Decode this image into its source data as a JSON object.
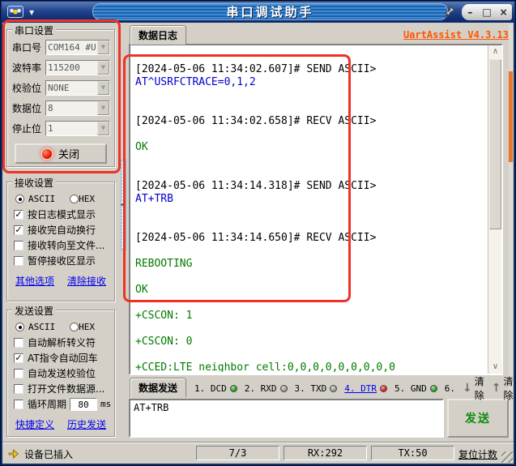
{
  "window": {
    "title": "串口调试助手",
    "min": "–",
    "max": "□",
    "close": "×"
  },
  "glyphs": {
    "menu_arrow": "▼",
    "combo_arrow": "▼",
    "check": "✓",
    "scroll_up": "∧",
    "scroll_down": "∨",
    "splitter_arrow": "◄"
  },
  "serial": {
    "title": "串口设置",
    "fields": [
      {
        "label": "串口号",
        "value": "COM164 #U"
      },
      {
        "label": "波特率",
        "value": "115200"
      },
      {
        "label": "校验位",
        "value": "NONE"
      },
      {
        "label": "数据位",
        "value": "8"
      },
      {
        "label": "停止位",
        "value": "1"
      }
    ],
    "close_button": "关闭"
  },
  "receive": {
    "title": "接收设置",
    "ascii": "ASCII",
    "hex": "HEX",
    "ascii_selected": true,
    "checks": [
      {
        "label": "按日志模式显示",
        "checked": true
      },
      {
        "label": "接收完自动换行",
        "checked": true
      },
      {
        "label": "接收转向至文件...",
        "checked": false
      },
      {
        "label": "暂停接收区显示",
        "checked": false
      }
    ],
    "links": [
      "其他选项",
      "清除接收"
    ]
  },
  "send": {
    "title": "发送设置",
    "ascii": "ASCII",
    "hex": "HEX",
    "ascii_selected": true,
    "checks": [
      {
        "label": "自动解析转义符",
        "checked": false
      },
      {
        "label": "AT指令自动回车",
        "checked": true
      },
      {
        "label": "自动发送校验位",
        "checked": false
      },
      {
        "label": "打开文件数据源...",
        "checked": false
      }
    ],
    "cycle": {
      "label": "循环周期",
      "value": "80",
      "unit": "ms",
      "checked": false
    },
    "links": [
      "快捷定义",
      "历史发送"
    ]
  },
  "main": {
    "log_tab": "数据日志",
    "version": "UartAssist V4.3.13",
    "log": [
      {
        "t": "[2024-05-06 11:34:02.607]# SEND ASCII>",
        "c": "m"
      },
      {
        "t": "AT^USRFCTRACE=0,1,2",
        "c": "s"
      },
      {
        "t": "",
        "c": "m"
      },
      {
        "t": "",
        "c": "m"
      },
      {
        "t": "[2024-05-06 11:34:02.658]# RECV ASCII>",
        "c": "m"
      },
      {
        "t": "",
        "c": "m"
      },
      {
        "t": "OK",
        "c": "r"
      },
      {
        "t": "",
        "c": "m"
      },
      {
        "t": "",
        "c": "m"
      },
      {
        "t": "[2024-05-06 11:34:14.318]# SEND ASCII>",
        "c": "m"
      },
      {
        "t": "AT+TRB",
        "c": "s"
      },
      {
        "t": "",
        "c": "m"
      },
      {
        "t": "",
        "c": "m"
      },
      {
        "t": "[2024-05-06 11:34:14.650]# RECV ASCII>",
        "c": "m"
      },
      {
        "t": "",
        "c": "m"
      },
      {
        "t": "REBOOTING",
        "c": "r"
      },
      {
        "t": "",
        "c": "m"
      },
      {
        "t": "OK",
        "c": "r"
      },
      {
        "t": "",
        "c": "m"
      },
      {
        "t": "+CSCON: 1",
        "c": "r"
      },
      {
        "t": "",
        "c": "m"
      },
      {
        "t": "+CSCON: 0",
        "c": "r"
      },
      {
        "t": "",
        "c": "m"
      },
      {
        "t": "+CCED:LTE neighbor cell:0,0,0,0,0,0,0,0,0",
        "c": "r"
      }
    ],
    "send_tab": "数据发送",
    "indicators": [
      {
        "label": "1. DCD",
        "color": "#1fa51f",
        "link": false
      },
      {
        "label": "2. RXD",
        "color": "#9a9a9a",
        "link": false
      },
      {
        "label": "3. TXD",
        "color": "#9a9a9a",
        "link": false
      },
      {
        "label": "4. DTR",
        "color": "#e01818",
        "link": true
      },
      {
        "label": "5. GND",
        "color": "#1fa51f",
        "link": false
      },
      {
        "label": "6.",
        "color": null,
        "link": false
      }
    ],
    "clear_buttons": [
      {
        "icon": "↓",
        "label": "清除"
      },
      {
        "icon": "↑",
        "label": "清除"
      }
    ],
    "input": "AT+TRB",
    "send_button": "发送"
  },
  "status": {
    "message": "设备已插入",
    "cells": [
      "7/3",
      "RX:292",
      "TX:50"
    ],
    "reset": "复位计数"
  },
  "colors": {
    "annotation_red": "#ee3226",
    "link_blue": "#0000ee",
    "version_orange": "#ff5500",
    "sent_blue": "#0000cc",
    "recv_green": "#007a00",
    "border_orange": "#e8792a"
  }
}
